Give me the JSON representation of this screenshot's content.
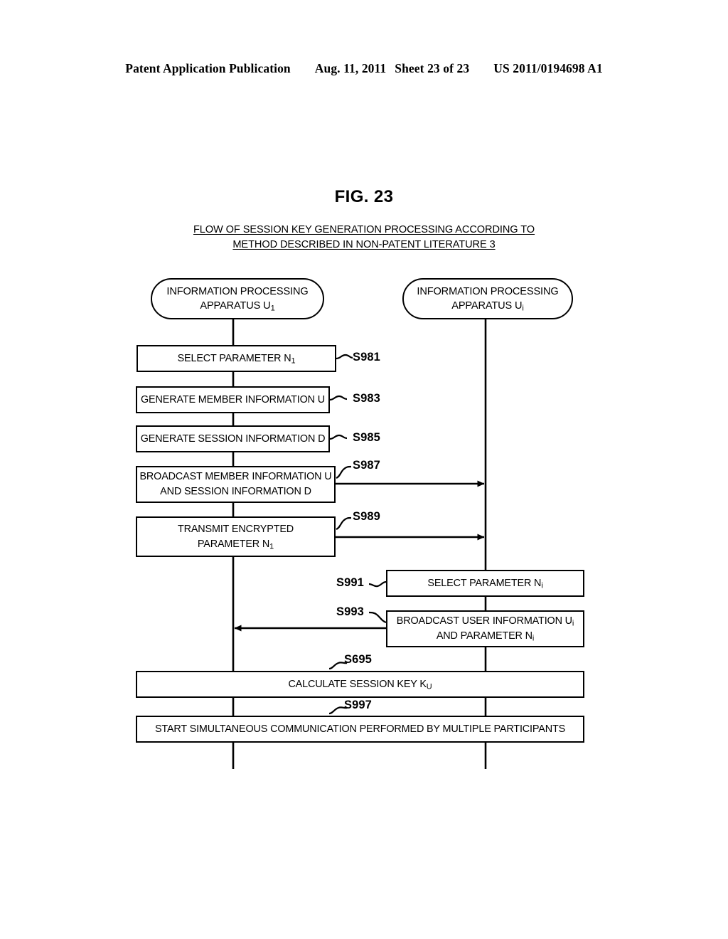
{
  "patent_header": {
    "publication": "Patent Application Publication",
    "date": "Aug. 11, 2011",
    "sheet": "Sheet 23 of 23",
    "number": "US 2011/0194698 A1"
  },
  "figure": {
    "number": "FIG. 23",
    "caption_line1": "FLOW OF SESSION KEY GENERATION PROCESSING ACCORDING TO",
    "caption_line2": "METHOD DESCRIBED IN NON-PATENT LITERATURE 3"
  },
  "lanes": [
    {
      "id": "left",
      "line1": "INFORMATION PROCESSING",
      "line2_prefix": "APPARATUS U",
      "line2_sub": "1"
    },
    {
      "id": "right",
      "line1": "INFORMATION PROCESSING",
      "line2_prefix": "APPARATUS U",
      "line2_sub": "i"
    }
  ],
  "steps": [
    {
      "id": "s981",
      "label": "S981",
      "lane": "left",
      "line1_prefix": "SELECT PARAMETER N",
      "line1_sub": "1",
      "line2_prefix": "",
      "line2_sub": ""
    },
    {
      "id": "s983",
      "label": "S983",
      "lane": "left",
      "line1_prefix": "GENERATE MEMBER INFORMATION U",
      "line1_sub": "",
      "line2_prefix": "",
      "line2_sub": ""
    },
    {
      "id": "s985",
      "label": "S985",
      "lane": "left",
      "line1_prefix": "GENERATE SESSION INFORMATION D",
      "line1_sub": "",
      "line2_prefix": "",
      "line2_sub": ""
    },
    {
      "id": "s987",
      "label": "S987",
      "lane": "left",
      "line1_prefix": "BROADCAST MEMBER INFORMATION U",
      "line1_sub": "",
      "line2_prefix": "AND SESSION INFORMATION D",
      "line2_sub": ""
    },
    {
      "id": "s989",
      "label": "S989",
      "lane": "left",
      "line1_prefix": "TRANSMIT ENCRYPTED",
      "line1_sub": "",
      "line2_prefix": "PARAMETER N",
      "line2_sub": "1"
    },
    {
      "id": "s991",
      "label": "S991",
      "lane": "right",
      "line1_prefix": "SELECT PARAMETER N",
      "line1_sub": "i",
      "line2_prefix": "",
      "line2_sub": ""
    },
    {
      "id": "s993",
      "label": "S993",
      "lane": "right",
      "line1_prefix": "BROADCAST USER INFORMATION U",
      "line1_sub": "i",
      "line2_prefix": "AND PARAMETER N",
      "line2_sub": "i"
    },
    {
      "id": "s695",
      "label": "S695",
      "lane": "both",
      "line1_prefix": "CALCULATE SESSION KEY K",
      "line1_sub": "U",
      "line2_prefix": "",
      "line2_sub": ""
    },
    {
      "id": "s997",
      "label": "S997",
      "lane": "both",
      "line1_prefix": "START SIMULTANEOUS COMMUNICATION PERFORMED BY MULTIPLE PARTICIPANTS",
      "line1_sub": "",
      "line2_prefix": "",
      "line2_sub": ""
    }
  ],
  "messages": [
    {
      "id": "msg-s987",
      "from": "left",
      "to": "right",
      "direction": "right"
    },
    {
      "id": "msg-s989",
      "from": "left",
      "to": "right",
      "direction": "right"
    },
    {
      "id": "msg-s993",
      "from": "right",
      "to": "left",
      "direction": "left"
    }
  ],
  "colors": {
    "ink": "#000000",
    "paper": "#ffffff"
  }
}
